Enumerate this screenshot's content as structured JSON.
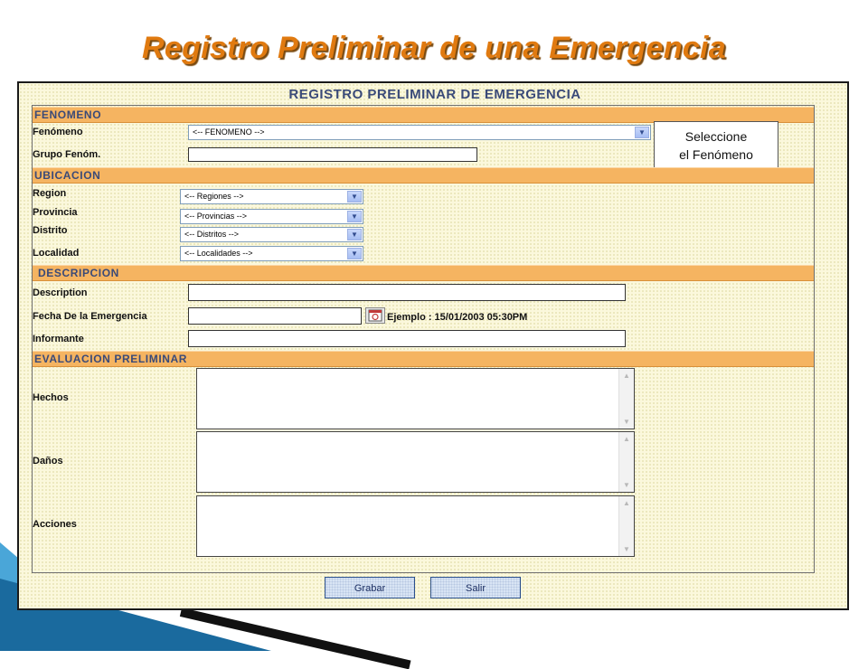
{
  "slide": {
    "title": "Registro Preliminar de una Emergencia"
  },
  "form": {
    "heading": "REGISTRO PRELIMINAR DE EMERGENCIA",
    "sections": {
      "fenomeno": "FENOMENO",
      "ubicacion": "UBICACION",
      "descripcion": "DESCRIPCION",
      "evaluacion": "EVALUACION PRELIMINAR"
    },
    "fenomeno": {
      "fenomeno_label": "Fenómeno",
      "fenomeno_value": "<-- FENOMENO -->",
      "grupo_label": "Grupo Fenóm.",
      "grupo_value": ""
    },
    "ubicacion": {
      "region_label": "Region",
      "region_value": "<-- Regiones -->",
      "provincia_label": "Provincia",
      "provincia_value": "<-- Provincias -->",
      "distrito_label": "Distrito",
      "distrito_value": "<-- Distritos -->",
      "localidad_label": "Localidad",
      "localidad_value": "<-- Localidades -->"
    },
    "descripcion": {
      "description_label": "Description",
      "description_value": "",
      "fecha_label": "Fecha De la Emergencia",
      "fecha_value": "",
      "fecha_example": "Ejemplo : 15/01/2003 05:30PM",
      "informante_label": "Informante",
      "informante_value": ""
    },
    "evaluacion": {
      "hechos_label": "Hechos",
      "danos_label": "Daños",
      "acciones_label": "Acciones"
    },
    "buttons": {
      "grabar": "Grabar",
      "salir": "Salir"
    }
  },
  "tooltip": {
    "line1": "Seleccione",
    "line2": "el Fenómeno"
  },
  "colors": {
    "title": "#e07a10",
    "section_band": "#f5b461",
    "form_background": "#fbf8dc",
    "heading_text": "#3a4a78"
  }
}
